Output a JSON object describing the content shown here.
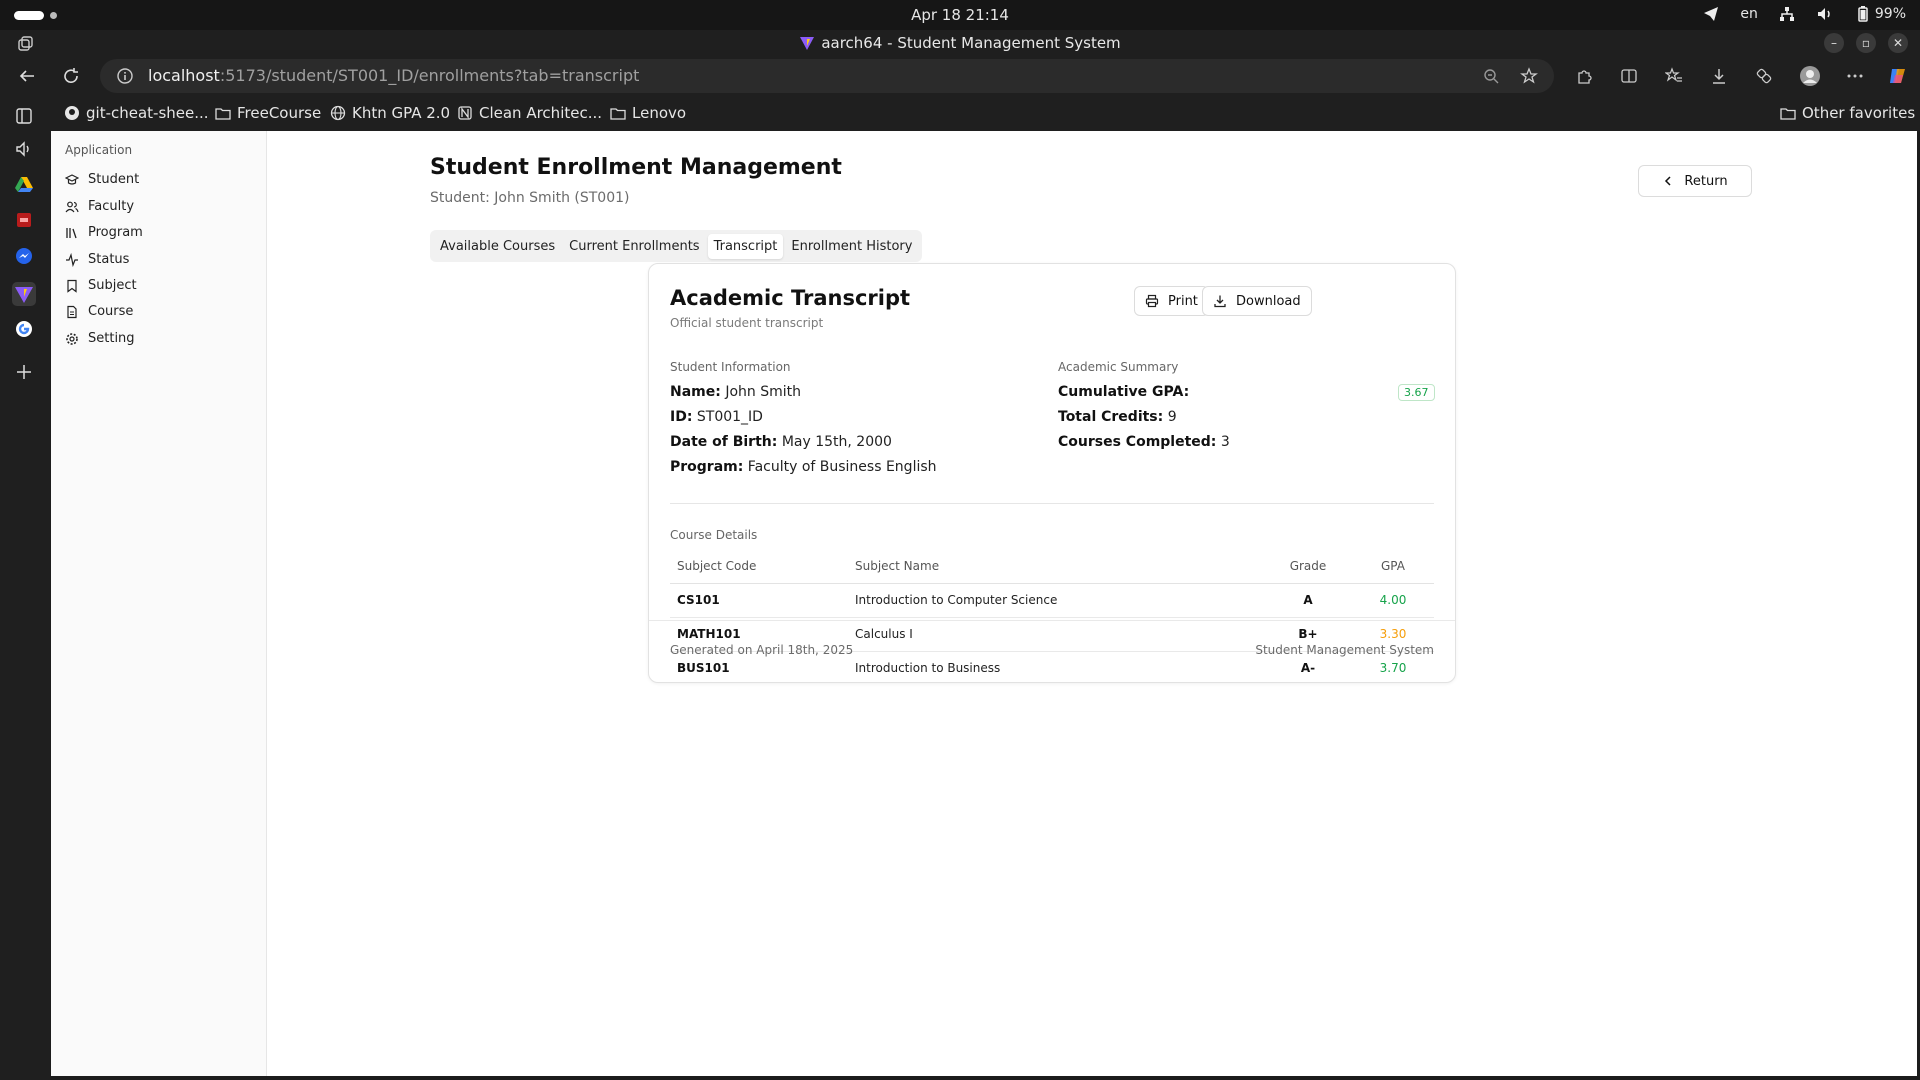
{
  "os": {
    "clock": "Apr 18  21:14",
    "lang": "en",
    "battery": "99%"
  },
  "browser": {
    "window_title": "aarch64 - Student Management System",
    "url_host": "localhost",
    "url_path": ":5173/student/ST001_ID/enrollments?tab=transcript",
    "bookmarks": [
      "git-cheat-shee...",
      "FreeCourse",
      "Khtn GPA 2.0",
      "Clean Architec...",
      "Lenovo"
    ],
    "other_favorites": "Other favorites"
  },
  "sidebar": {
    "group_label": "Application",
    "items": [
      {
        "label": "Student",
        "icon": "graduation-cap-icon"
      },
      {
        "label": "Faculty",
        "icon": "users-icon"
      },
      {
        "label": "Program",
        "icon": "library-icon"
      },
      {
        "label": "Status",
        "icon": "activity-icon"
      },
      {
        "label": "Subject",
        "icon": "bookmark-icon"
      },
      {
        "label": "Course",
        "icon": "file-icon"
      },
      {
        "label": "Setting",
        "icon": "gear-icon"
      }
    ]
  },
  "header": {
    "title": "Student Enrollment Management",
    "subtitle": "Student: John Smith (ST001)",
    "return_label": "Return"
  },
  "tabs": [
    {
      "label": "Available Courses",
      "active": false
    },
    {
      "label": "Current Enrollments",
      "active": false
    },
    {
      "label": "Transcript",
      "active": true
    },
    {
      "label": "Enrollment History",
      "active": false
    }
  ],
  "transcript": {
    "title": "Academic Transcript",
    "subtitle": "Official student transcript",
    "print_label": "Print",
    "download_label": "Download",
    "student_info": {
      "heading": "Student Information",
      "name_label": "Name:",
      "name": "John Smith",
      "id_label": "ID:",
      "id": "ST001_ID",
      "dob_label": "Date of Birth:",
      "dob": "May 15th, 2000",
      "program_label": "Program:",
      "program": "Faculty of Business English"
    },
    "summary": {
      "heading": "Academic Summary",
      "gpa_label": "Cumulative GPA:",
      "gpa": "3.67",
      "credits_label": "Total Credits:",
      "credits": "9",
      "completed_label": "Courses Completed:",
      "completed": "3"
    },
    "course_details": {
      "heading": "Course Details",
      "columns": [
        "Subject Code",
        "Subject Name",
        "Grade",
        "GPA"
      ],
      "rows": [
        {
          "code": "CS101",
          "name": "Introduction to Computer Science",
          "grade": "A",
          "gpa": "4.00",
          "gpa_color": "#16a34a"
        },
        {
          "code": "MATH101",
          "name": "Calculus I",
          "grade": "B+",
          "gpa": "3.30",
          "gpa_color": "#f59e0b"
        },
        {
          "code": "BUS101",
          "name": "Introduction to Business",
          "grade": "A-",
          "gpa": "3.70",
          "gpa_color": "#16a34a"
        }
      ]
    },
    "footer_left": "Generated on April 18th, 2025",
    "footer_right": "Student Management System"
  },
  "colors": {
    "gpa_good": "#16a34a",
    "gpa_mid": "#f59e0b"
  }
}
